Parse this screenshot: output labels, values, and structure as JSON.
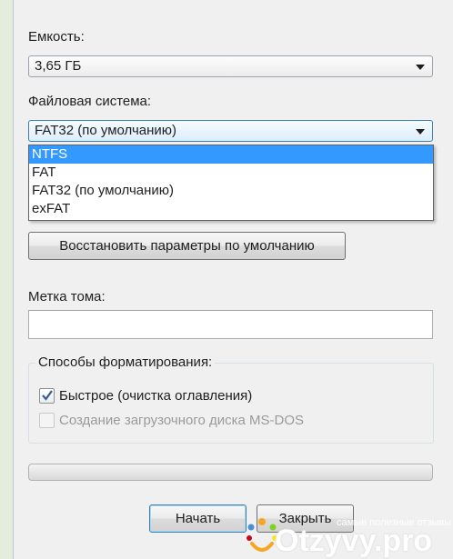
{
  "capacity": {
    "label": "Емкость:",
    "selected": "3,65 ГБ"
  },
  "filesystem": {
    "label": "Файловая система:",
    "selected": "FAT32 (по умолчанию)",
    "options": [
      "NTFS",
      "FAT",
      "FAT32 (по умолчанию)",
      "exFAT"
    ],
    "highlighted_option": "NTFS"
  },
  "restore_defaults_label": "Восстановить параметры по умолчанию",
  "volume_label": {
    "label": "Метка тома:",
    "value": ""
  },
  "format_options": {
    "title": "Способы форматирования:",
    "quick": {
      "label": "Быстрое (очистка оглавления)",
      "checked": true
    },
    "msdos": {
      "label": "Создание загрузочного диска MS-DOS",
      "checked": false,
      "enabled": false
    }
  },
  "progress": {
    "value": 0
  },
  "buttons": {
    "start": "Начать",
    "close": "Закрыть"
  },
  "watermark": {
    "brand": "Otzyvy.pro",
    "tagline": "самые полезные отзывы"
  },
  "colors": {
    "selection": "#3399ff",
    "focus_border": "#3c7fb1",
    "window_bg": "#f0f0f0"
  }
}
